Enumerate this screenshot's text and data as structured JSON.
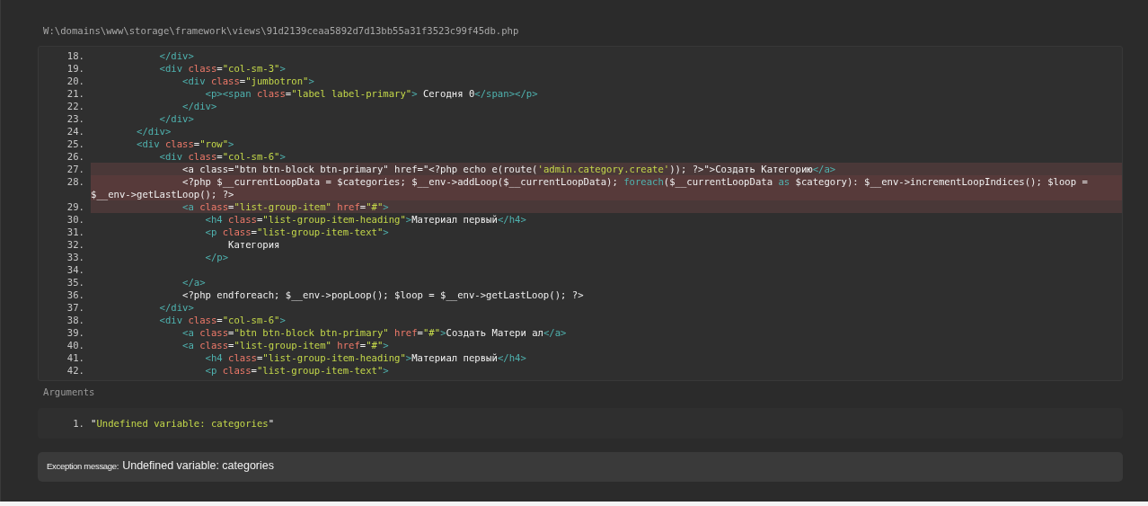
{
  "file_path": "W:\\domains\\www\\storage\\framework\\views\\91d2139ceaa5892d7d13bb55a31f3523c99f45db.php",
  "code_lines": [
    {
      "number": "18.",
      "highlighted": false,
      "error": false,
      "tokens": [
        {
          "kind": "tag",
          "text": "            </div>"
        }
      ]
    },
    {
      "number": "19.",
      "highlighted": false,
      "error": false,
      "tokens": [
        {
          "kind": "tag",
          "text": "            <div "
        },
        {
          "kind": "attr",
          "text": "class"
        },
        {
          "kind": "plain",
          "text": "="
        },
        {
          "kind": "string",
          "text": "\"col-sm-3\""
        },
        {
          "kind": "tag",
          "text": ">"
        }
      ]
    },
    {
      "number": "20.",
      "highlighted": false,
      "error": false,
      "tokens": [
        {
          "kind": "tag",
          "text": "                <div "
        },
        {
          "kind": "attr",
          "text": "class"
        },
        {
          "kind": "plain",
          "text": "="
        },
        {
          "kind": "string",
          "text": "\"jumbotron\""
        },
        {
          "kind": "tag",
          "text": ">"
        }
      ]
    },
    {
      "number": "21.",
      "highlighted": false,
      "error": false,
      "tokens": [
        {
          "kind": "tag",
          "text": "                    <p><span "
        },
        {
          "kind": "attr",
          "text": "class"
        },
        {
          "kind": "plain",
          "text": "="
        },
        {
          "kind": "string",
          "text": "\"label label-primary\""
        },
        {
          "kind": "tag",
          "text": ">"
        },
        {
          "kind": "plain",
          "text": " Сегодня 0"
        },
        {
          "kind": "tag",
          "text": "</span></p>"
        }
      ]
    },
    {
      "number": "22.",
      "highlighted": false,
      "error": false,
      "tokens": [
        {
          "kind": "tag",
          "text": "                </div>"
        }
      ]
    },
    {
      "number": "23.",
      "highlighted": false,
      "error": false,
      "tokens": [
        {
          "kind": "tag",
          "text": "            </div>"
        }
      ]
    },
    {
      "number": "24.",
      "highlighted": false,
      "error": false,
      "tokens": [
        {
          "kind": "tag",
          "text": "        </div>"
        }
      ]
    },
    {
      "number": "25.",
      "highlighted": false,
      "error": false,
      "tokens": [
        {
          "kind": "tag",
          "text": "        <div "
        },
        {
          "kind": "attr",
          "text": "class"
        },
        {
          "kind": "plain",
          "text": "="
        },
        {
          "kind": "string",
          "text": "\"row\""
        },
        {
          "kind": "tag",
          "text": ">"
        }
      ]
    },
    {
      "number": "26.",
      "highlighted": false,
      "error": false,
      "tokens": [
        {
          "kind": "tag",
          "text": "            <div "
        },
        {
          "kind": "attr",
          "text": "class"
        },
        {
          "kind": "plain",
          "text": "="
        },
        {
          "kind": "string",
          "text": "\"col-sm-6\""
        },
        {
          "kind": "tag",
          "text": ">"
        }
      ]
    },
    {
      "number": "27.",
      "highlighted": true,
      "error": false,
      "tokens": [
        {
          "kind": "plain",
          "text": "                <a class=\"btn btn-block btn-primary\" href=\"<?php echo e(route("
        },
        {
          "kind": "string",
          "text": "'admin.category.create'"
        },
        {
          "kind": "plain",
          "text": ")); ?>\">Создать Категорию"
        },
        {
          "kind": "tag",
          "text": "</a>"
        }
      ]
    },
    {
      "number": "28.",
      "highlighted": true,
      "error": true,
      "tokens": [
        {
          "kind": "plain",
          "text": "                <?php $__currentLoopData = $categories; $__env->addLoop($__currentLoopData); "
        },
        {
          "kind": "keyword",
          "text": "foreach"
        },
        {
          "kind": "plain",
          "text": "($__currentLoopData "
        },
        {
          "kind": "keyword",
          "text": "as"
        },
        {
          "kind": "plain",
          "text": " $category): $__env->incrementLoopIndices(); $loop = $__env->getLastLoop(); ?>"
        }
      ]
    },
    {
      "number": "29.",
      "highlighted": true,
      "error": false,
      "tokens": [
        {
          "kind": "tag",
          "text": "                <a "
        },
        {
          "kind": "attr",
          "text": "class"
        },
        {
          "kind": "plain",
          "text": "="
        },
        {
          "kind": "string",
          "text": "\"list-group-item\""
        },
        {
          "kind": "attr",
          "text": " href"
        },
        {
          "kind": "plain",
          "text": "="
        },
        {
          "kind": "string",
          "text": "\"#\""
        },
        {
          "kind": "tag",
          "text": ">"
        }
      ]
    },
    {
      "number": "30.",
      "highlighted": false,
      "error": false,
      "tokens": [
        {
          "kind": "tag",
          "text": "                    <h4 "
        },
        {
          "kind": "attr",
          "text": "class"
        },
        {
          "kind": "plain",
          "text": "="
        },
        {
          "kind": "string",
          "text": "\"list-group-item-heading\""
        },
        {
          "kind": "tag",
          "text": ">"
        },
        {
          "kind": "plain",
          "text": "Материал первый"
        },
        {
          "kind": "tag",
          "text": "</h4>"
        }
      ]
    },
    {
      "number": "31.",
      "highlighted": false,
      "error": false,
      "tokens": [
        {
          "kind": "tag",
          "text": "                    <p "
        },
        {
          "kind": "attr",
          "text": "class"
        },
        {
          "kind": "plain",
          "text": "="
        },
        {
          "kind": "string",
          "text": "\"list-group-item-text\""
        },
        {
          "kind": "tag",
          "text": ">"
        }
      ]
    },
    {
      "number": "32.",
      "highlighted": false,
      "error": false,
      "tokens": [
        {
          "kind": "plain",
          "text": "                        Категория"
        }
      ]
    },
    {
      "number": "33.",
      "highlighted": false,
      "error": false,
      "tokens": [
        {
          "kind": "tag",
          "text": "                    </p>"
        }
      ]
    },
    {
      "number": "34.",
      "highlighted": false,
      "error": false
    },
    {
      "number": "35.",
      "highlighted": false,
      "error": false,
      "tokens": [
        {
          "kind": "tag",
          "text": "                </a>"
        }
      ]
    },
    {
      "number": "36.",
      "highlighted": false,
      "error": false,
      "tokens": [
        {
          "kind": "plain",
          "text": "                <?php endforeach; $__env->popLoop(); $loop = $__env->getLastLoop(); ?>"
        }
      ]
    },
    {
      "number": "37.",
      "highlighted": false,
      "error": false,
      "tokens": [
        {
          "kind": "tag",
          "text": "            </div>"
        }
      ]
    },
    {
      "number": "38.",
      "highlighted": false,
      "error": false,
      "tokens": [
        {
          "kind": "tag",
          "text": "            <div "
        },
        {
          "kind": "attr",
          "text": "class"
        },
        {
          "kind": "plain",
          "text": "="
        },
        {
          "kind": "string",
          "text": "\"col-sm-6\""
        },
        {
          "kind": "tag",
          "text": ">"
        }
      ]
    },
    {
      "number": "39.",
      "highlighted": false,
      "error": false,
      "tokens": [
        {
          "kind": "tag",
          "text": "                <a "
        },
        {
          "kind": "attr",
          "text": "class"
        },
        {
          "kind": "plain",
          "text": "="
        },
        {
          "kind": "string",
          "text": "\"btn btn-block btn-primary\""
        },
        {
          "kind": "attr",
          "text": " href"
        },
        {
          "kind": "plain",
          "text": "="
        },
        {
          "kind": "string",
          "text": "\"#\""
        },
        {
          "kind": "tag",
          "text": ">"
        },
        {
          "kind": "plain",
          "text": "Создать Матери ал"
        },
        {
          "kind": "tag",
          "text": "</a>"
        }
      ]
    },
    {
      "number": "40.",
      "highlighted": false,
      "error": false,
      "tokens": [
        {
          "kind": "tag",
          "text": "                <a "
        },
        {
          "kind": "attr",
          "text": "class"
        },
        {
          "kind": "plain",
          "text": "="
        },
        {
          "kind": "string",
          "text": "\"list-group-item\""
        },
        {
          "kind": "attr",
          "text": " href"
        },
        {
          "kind": "plain",
          "text": "="
        },
        {
          "kind": "string",
          "text": "\"#\""
        },
        {
          "kind": "tag",
          "text": ">"
        }
      ]
    },
    {
      "number": "41.",
      "highlighted": false,
      "error": false,
      "tokens": [
        {
          "kind": "tag",
          "text": "                    <h4 "
        },
        {
          "kind": "attr",
          "text": "class"
        },
        {
          "kind": "plain",
          "text": "="
        },
        {
          "kind": "string",
          "text": "\"list-group-item-heading\""
        },
        {
          "kind": "tag",
          "text": ">"
        },
        {
          "kind": "plain",
          "text": "Материал первый"
        },
        {
          "kind": "tag",
          "text": "</h4>"
        }
      ]
    },
    {
      "number": "42.",
      "highlighted": false,
      "error": false,
      "tokens": [
        {
          "kind": "tag",
          "text": "                    <p "
        },
        {
          "kind": "attr",
          "text": "class"
        },
        {
          "kind": "plain",
          "text": "="
        },
        {
          "kind": "string",
          "text": "\"list-group-item-text\""
        },
        {
          "kind": "tag",
          "text": ">"
        }
      ]
    }
  ],
  "arguments": {
    "heading": "Arguments",
    "items": [
      {
        "number": "1.",
        "tokens": [
          {
            "kind": "plain",
            "text": "\""
          },
          {
            "kind": "string",
            "text": "Undefined variable: categories"
          },
          {
            "kind": "plain",
            "text": "\""
          }
        ]
      }
    ]
  },
  "exception": {
    "label": "Exception message:",
    "message": "Undefined variable: categories"
  }
}
